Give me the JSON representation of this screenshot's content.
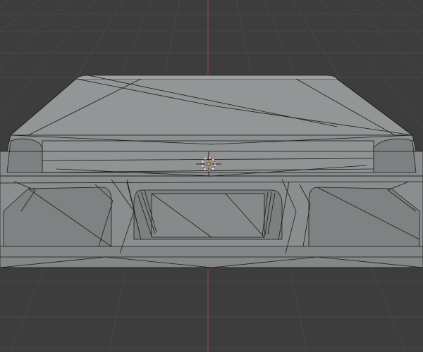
{
  "viewport": {
    "background_color": "#3d3d3d",
    "grid_color": "#484848",
    "axis_z_color": "#b5474f",
    "mesh_face_color": "#8f9394",
    "mesh_edge_color": "#1e1e1e"
  },
  "icons": {
    "cursor": "3d-cursor-icon",
    "origin": "object-origin-icon"
  }
}
